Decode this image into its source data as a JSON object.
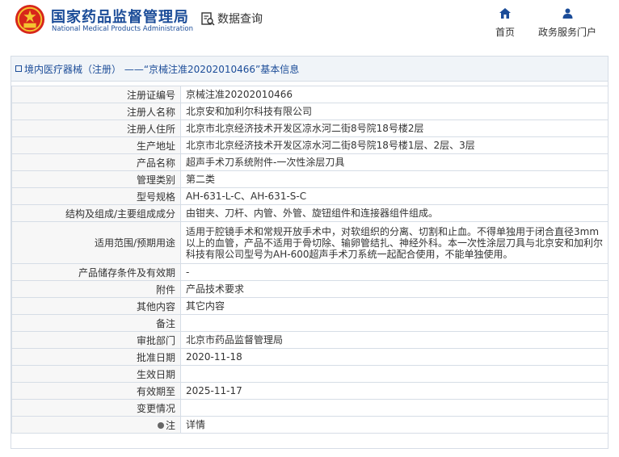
{
  "header": {
    "brand_cn": "国家药品监督管理局",
    "brand_en": "National Medical Products Administration",
    "query_label": "数据查询",
    "nav": [
      {
        "label": "首页",
        "icon": "home-icon"
      },
      {
        "label": "政务服务门户",
        "icon": "user-icon"
      }
    ]
  },
  "panel": {
    "title": "境内医疗器械（注册） ——“京械注准20202010466”基本信息"
  },
  "rows": [
    {
      "key": "注册证编号",
      "value": "京械注准20202010466"
    },
    {
      "key": "注册人名称",
      "value": "北京安和加利尔科技有限公司"
    },
    {
      "key": "注册人住所",
      "value": "北京市北京经济技术开发区凉水河二街8号院18号楼2层"
    },
    {
      "key": "生产地址",
      "value": "北京市北京经济技术开发区凉水河二街8号院18号楼1层、2层、3层"
    },
    {
      "key": "产品名称",
      "value": "超声手术刀系统附件-一次性涂层刀具"
    },
    {
      "key": "管理类别",
      "value": "第二类"
    },
    {
      "key": "型号规格",
      "value": "AH-631-L-C、AH-631-S-C"
    },
    {
      "key": "结构及组成/主要组成成分",
      "value": "由钳夹、刀杆、内管、外管、旋钮组件和连接器组件组成。"
    },
    {
      "key": "适用范围/预期用途",
      "value": "适用于腔镜手术和常规开放手术中，对软组织的分离、切割和止血。不得单独用于闭合直径3mm以上的血管，产品不适用于骨切除、输卵管结扎、神经外科。本一次性涂层刀具与北京安和加利尔科技有限公司型号为AH-600超声手术刀系统一起配合使用，不能单独使用。"
    },
    {
      "key": "产品储存条件及有效期",
      "value": "-"
    },
    {
      "key": "附件",
      "value": "产品技术要求"
    },
    {
      "key": "其他内容",
      "value": "其它内容"
    },
    {
      "key": "备注",
      "value": ""
    },
    {
      "key": "审批部门",
      "value": "北京市药品监督管理局"
    },
    {
      "key": "批准日期",
      "value": "2020-11-18"
    },
    {
      "key": "生效日期",
      "value": ""
    },
    {
      "key": "有效期至",
      "value": "2025-11-17"
    },
    {
      "key": "变更情况",
      "value": ""
    },
    {
      "key": "注",
      "value": "详情"
    }
  ]
}
